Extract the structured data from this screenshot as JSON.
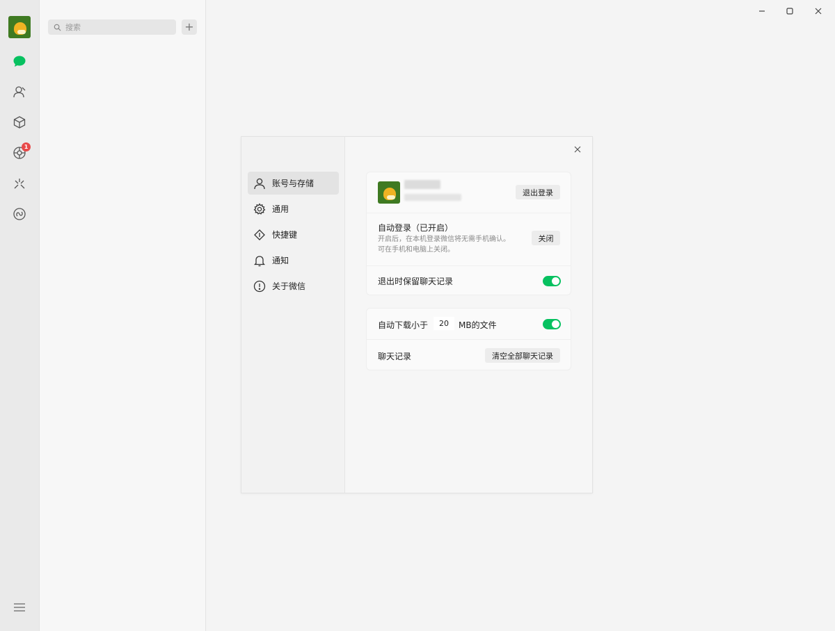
{
  "search": {
    "placeholder": "搜索"
  },
  "add_button": "+",
  "rail": {
    "badge_count": "1"
  },
  "dialog": {
    "nav": [
      {
        "label": "账号与存储",
        "icon": "person-icon",
        "active": true
      },
      {
        "label": "通用",
        "icon": "gear-icon"
      },
      {
        "label": "快捷键",
        "icon": "shortcut-icon"
      },
      {
        "label": "通知",
        "icon": "bell-icon"
      },
      {
        "label": "关于微信",
        "icon": "info-icon"
      }
    ],
    "account": {
      "logout_label": "退出登录",
      "auto_login_title": "自动登录（已开启）",
      "auto_login_desc_1": "开启后，在本机登录微信将无需手机确认。",
      "auto_login_desc_2": "可在手机和电脑上关闭。",
      "auto_login_button": "关闭",
      "keep_history_label": "退出时保留聊天记录",
      "keep_history_enabled": true
    },
    "storage": {
      "auto_download_prefix": "自动下载小于",
      "auto_download_value": "20",
      "auto_download_suffix": "MB的文件",
      "auto_download_enabled": true,
      "chat_history_label": "聊天记录",
      "clear_history_button": "清空全部聊天记录"
    }
  },
  "colors": {
    "accent": "#07c160",
    "badge": "#e84a4a"
  }
}
